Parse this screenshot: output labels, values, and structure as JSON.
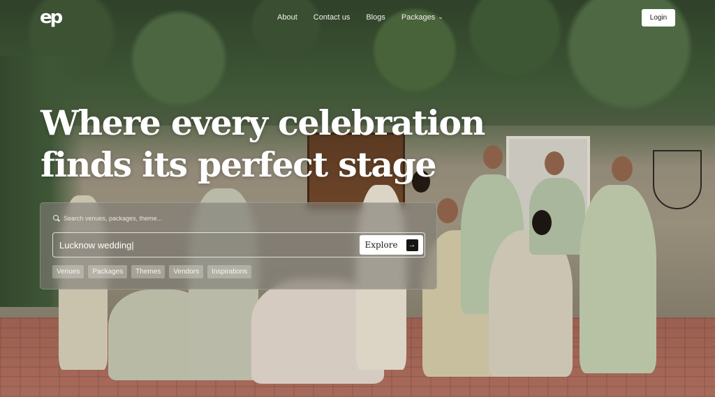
{
  "brand": {
    "logo_text": "ep"
  },
  "nav": {
    "links": [
      {
        "label": "About"
      },
      {
        "label": "Contact us"
      },
      {
        "label": "Blogs"
      },
      {
        "label": "Packages"
      }
    ],
    "login_label": "Login"
  },
  "hero": {
    "headline_line1": "Where every celebration",
    "headline_line2": "finds its perfect stage"
  },
  "search": {
    "hint": "Search venues, packages, theme...",
    "value": "Lucknow wedding|",
    "button_label": "Explore",
    "chips": [
      "Venues",
      "Packages",
      "Themes",
      "Vendors",
      "Inspirations"
    ]
  },
  "colors": {
    "panel": "#807c76",
    "button": "#ffffff",
    "headline": "#ffffff"
  },
  "icons": {
    "search": "search-icon",
    "explore_arrow": "arrow-right-icon",
    "packages_dropdown": "chevron-down-icon"
  }
}
